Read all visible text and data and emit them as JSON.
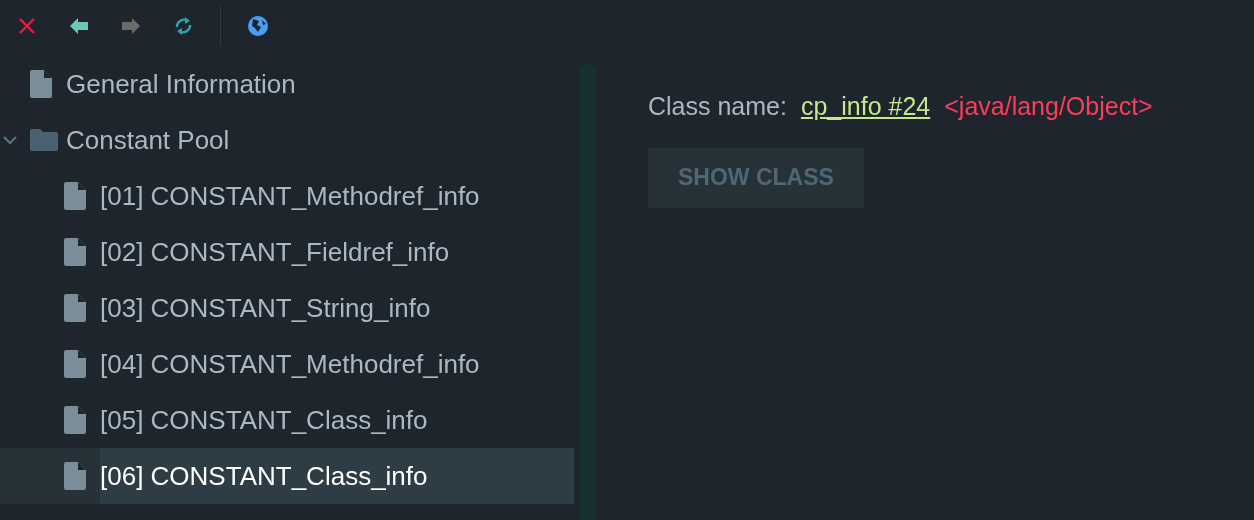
{
  "toolbar": {
    "buttons": [
      {
        "kind": "close",
        "disabled": false
      },
      {
        "kind": "back",
        "disabled": false
      },
      {
        "kind": "forward",
        "disabled": true
      },
      {
        "kind": "refresh",
        "disabled": false
      },
      {
        "kind": "web",
        "disabled": false
      }
    ]
  },
  "tree": [
    {
      "label": "General Information",
      "kind": "file",
      "selected": false
    },
    {
      "label": "Constant Pool",
      "kind": "folder",
      "selected": false,
      "expanded": true,
      "children": [
        {
          "label": "[01] CONSTANT_Methodref_info",
          "kind": "file",
          "selected": false
        },
        {
          "label": "[02] CONSTANT_Fieldref_info",
          "kind": "file",
          "selected": false
        },
        {
          "label": "[03] CONSTANT_String_info",
          "kind": "file",
          "selected": false
        },
        {
          "label": "[04] CONSTANT_Methodref_info",
          "kind": "file",
          "selected": false
        },
        {
          "label": "[05] CONSTANT_Class_info",
          "kind": "file",
          "selected": false
        },
        {
          "label": "[06] CONSTANT_Class_info",
          "kind": "file",
          "selected": true
        }
      ]
    }
  ],
  "detail": {
    "label": "Class name:",
    "link": "cp_info #24",
    "value": "<java/lang/Object>",
    "button": "SHOW CLASS"
  }
}
